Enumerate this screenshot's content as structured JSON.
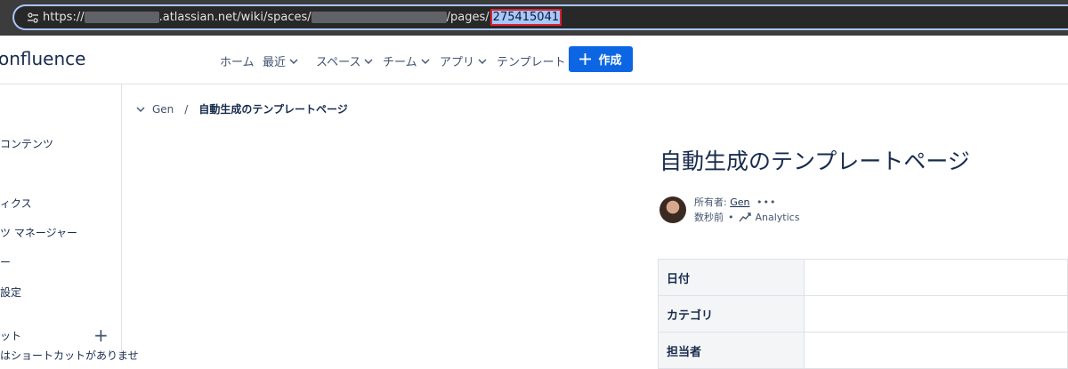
{
  "browser": {
    "url_prefix": "https://",
    "url_domain": ".atlassian.net/wiki/spaces/",
    "url_pages": "/pages/",
    "page_id": "275415041"
  },
  "header": {
    "product_name": "onfluence",
    "nav": [
      "ホーム",
      "最近",
      "スペース",
      "チーム",
      "アプリ",
      "テンプレート"
    ],
    "create_label": "作成"
  },
  "sidebar": {
    "items": [
      "コンテンツ",
      "ィクス",
      "ツ マネージャー",
      "ー",
      "設定",
      "ット",
      "はショートカットがありませ"
    ]
  },
  "breadcrumb": {
    "parent": "Gen",
    "separator": "/",
    "current": "自動生成のテンプレートページ"
  },
  "page": {
    "title": "自動生成のテンプレートページ",
    "owner_prefix": "所有者: ",
    "owner": "Gen",
    "more": "•••",
    "time": "数秒前",
    "dot": "•",
    "analytics": "Analytics"
  },
  "table": {
    "rows": [
      "日付",
      "カテゴリ",
      "担当者"
    ]
  },
  "colors": {
    "accent": "#0c66e4",
    "highlight_border": "#d9222f"
  }
}
